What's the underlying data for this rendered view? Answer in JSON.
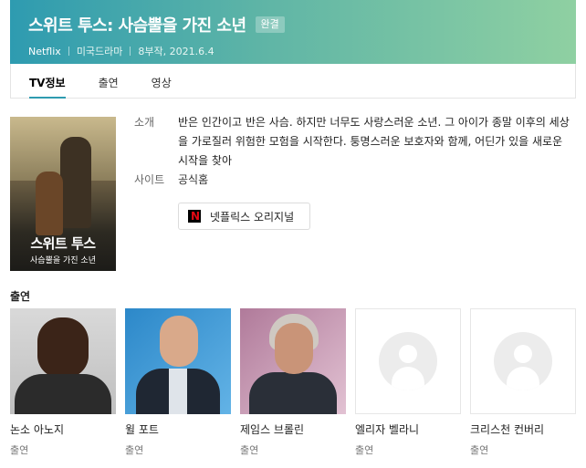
{
  "header": {
    "title": "스위트 투스: 사슴뿔을 가진 소년",
    "badge": "완결",
    "meta": [
      "Netflix",
      "미국드라마",
      "8부작, 2021.6.4"
    ]
  },
  "tabs": [
    {
      "label": "TV정보",
      "active": true
    },
    {
      "label": "출연",
      "active": false
    },
    {
      "label": "영상",
      "active": false
    }
  ],
  "poster": {
    "title": "스위트 투스",
    "subtitle": "사슴뿔을 가진 소년"
  },
  "info": {
    "intro_label": "소개",
    "intro_text": "반은 인간이고 반은 사슴. 하지만 너무도 사랑스러운 소년. 그 아이가 종말 이후의 세상을 가로질러 위험한 모험을 시작한다. 퉁명스러운 보호자와 함께, 어딘가 있을 새로운 시작을 찾아",
    "site_label": "사이트",
    "site_link": "공식홈"
  },
  "netflix_button": {
    "logo_letter": "N",
    "label": "넷플릭스 오리지널"
  },
  "cast": {
    "heading": "출연",
    "members": [
      {
        "name": "논소 아노지",
        "role": "출연",
        "has_photo": true
      },
      {
        "name": "윌 포트",
        "role": "출연",
        "has_photo": true
      },
      {
        "name": "제임스 브롤린",
        "role": "출연",
        "has_photo": true
      },
      {
        "name": "엘리자 벨라니",
        "role": "출연",
        "has_photo": false
      },
      {
        "name": "크리스천 컨버리",
        "role": "출연",
        "has_photo": false
      }
    ]
  },
  "colors": {
    "header_start": "#2e9bb0",
    "header_end": "#8fd0a2",
    "netflix_red": "#e50914"
  }
}
